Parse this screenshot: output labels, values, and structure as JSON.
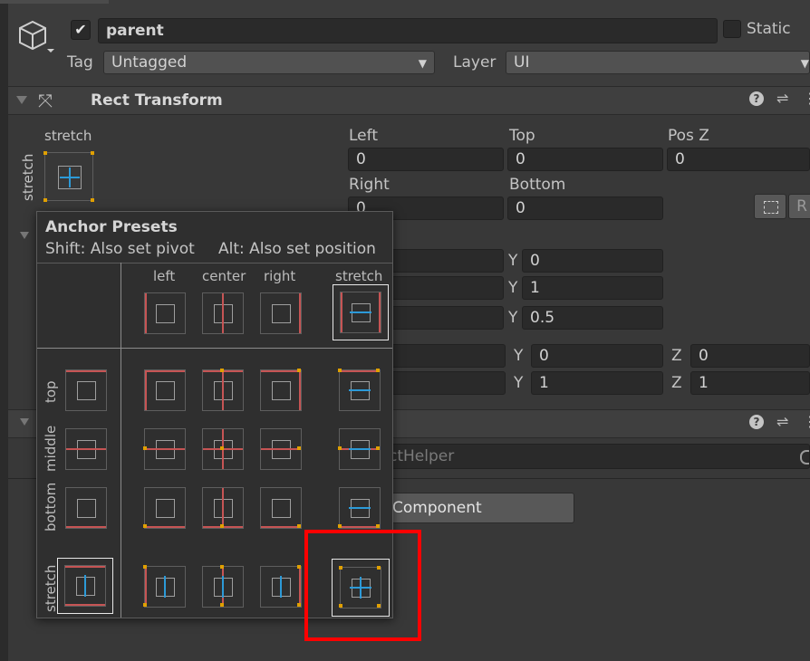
{
  "object": {
    "active_checked": true,
    "name": "parent",
    "static_label": "Static",
    "tag_label": "Tag",
    "tag_value": "Untagged",
    "layer_label": "Layer",
    "layer_value": "UI"
  },
  "rect_transform": {
    "title": "Rect Transform",
    "anchor_h": "stretch",
    "anchor_v": "stretch",
    "fields_row1": [
      {
        "label": "Left",
        "value": "0"
      },
      {
        "label": "Top",
        "value": "0"
      },
      {
        "label": "Pos Z",
        "value": "0"
      }
    ],
    "fields_row2": [
      {
        "label": "Right",
        "value": "0"
      },
      {
        "label": "Bottom",
        "value": "0"
      }
    ],
    "r_button": "R",
    "anchor_y": [
      "Y",
      "0"
    ],
    "anchor_y2": [
      "Y",
      "1"
    ],
    "pivot_y": [
      "Y",
      "0.5"
    ],
    "rotation": {
      "y_label": "Y",
      "y": "0",
      "z_label": "Z",
      "z": "0"
    },
    "scale": {
      "y_label": "Y",
      "y": "1",
      "z_label": "Z",
      "z": "1"
    }
  },
  "script": {
    "value": "ctHelper"
  },
  "add_component": "Component",
  "popup": {
    "title": "Anchor Presets",
    "hint_left": "Shift: Also set pivot",
    "hint_right": "Alt: Also set position",
    "columns": [
      "left",
      "center",
      "right",
      "stretch"
    ],
    "rows": [
      "top",
      "middle",
      "bottom",
      "stretch"
    ]
  },
  "colors": {
    "highlight_box": "#ff0000",
    "anchor_red": "#c65454",
    "anchor_dot": "#e0a000",
    "stretch_blue": "#2c9ad8"
  }
}
